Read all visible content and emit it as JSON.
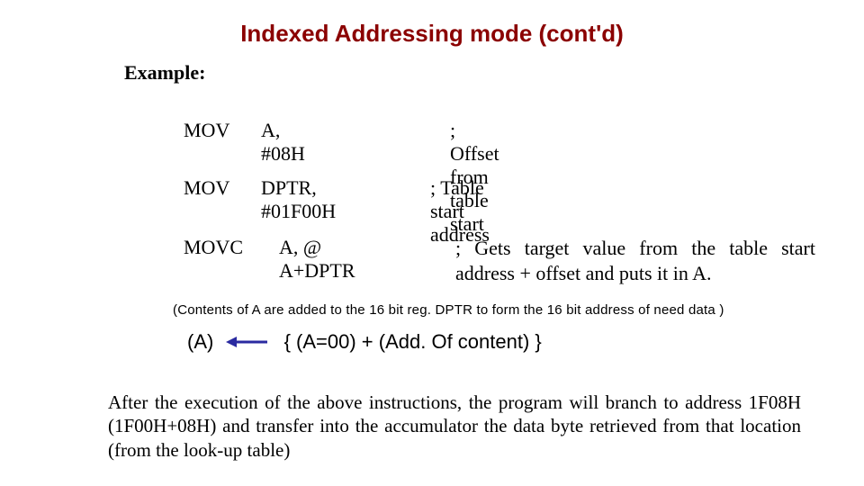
{
  "title": "Indexed Addressing mode (cont'd)",
  "example_label": "Example:",
  "lines": {
    "l1": {
      "mnemonic": "MOV",
      "operand": "A, #08H",
      "comment": "; Offset from table start"
    },
    "l2": {
      "mnemonic": "MOV",
      "operand": "DPTR, #01F00H",
      "comment": "; Table start address"
    },
    "l3": {
      "mnemonic": "MOVC",
      "operand": "A, @ A+DPTR",
      "comment": "; Gets target value from the table start address + offset and puts it in A."
    }
  },
  "contents_note": "(Contents of A are added to the 16 bit reg. DPTR to form the 16 bit address of need data )",
  "equation": {
    "lhs": "(A)",
    "rhs": "{ (A=00) + (Add. Of content) }"
  },
  "after_text": "After the execution of the above instructions, the program will branch to address 1F08H (1F00H+08H) and transfer into the accumulator the data byte retrieved from that location (from the look-up table)"
}
